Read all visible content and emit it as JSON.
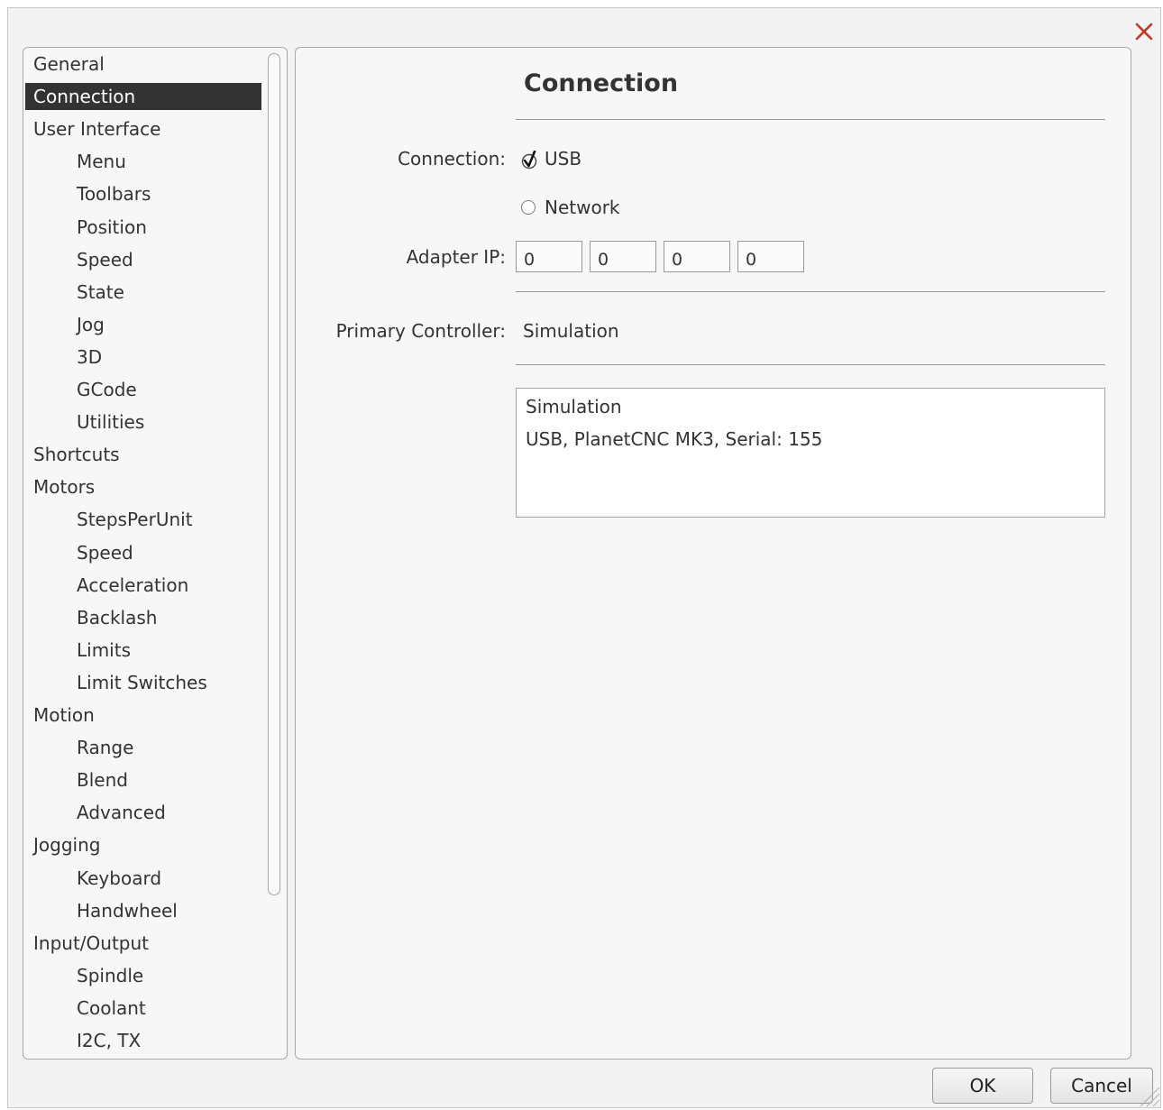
{
  "sidebar": {
    "items": [
      {
        "label": "General",
        "level": 0,
        "selected": false
      },
      {
        "label": "Connection",
        "level": 0,
        "selected": true
      },
      {
        "label": "User Interface",
        "level": 0,
        "selected": false
      },
      {
        "label": "Menu",
        "level": 1,
        "selected": false
      },
      {
        "label": "Toolbars",
        "level": 1,
        "selected": false
      },
      {
        "label": "Position",
        "level": 1,
        "selected": false
      },
      {
        "label": "Speed",
        "level": 1,
        "selected": false
      },
      {
        "label": "State",
        "level": 1,
        "selected": false
      },
      {
        "label": "Jog",
        "level": 1,
        "selected": false
      },
      {
        "label": "3D",
        "level": 1,
        "selected": false
      },
      {
        "label": "GCode",
        "level": 1,
        "selected": false
      },
      {
        "label": "Utilities",
        "level": 1,
        "selected": false
      },
      {
        "label": "Shortcuts",
        "level": 0,
        "selected": false
      },
      {
        "label": "Motors",
        "level": 0,
        "selected": false
      },
      {
        "label": "StepsPerUnit",
        "level": 1,
        "selected": false
      },
      {
        "label": "Speed",
        "level": 1,
        "selected": false
      },
      {
        "label": "Acceleration",
        "level": 1,
        "selected": false
      },
      {
        "label": "Backlash",
        "level": 1,
        "selected": false
      },
      {
        "label": "Limits",
        "level": 1,
        "selected": false
      },
      {
        "label": "Limit Switches",
        "level": 1,
        "selected": false
      },
      {
        "label": "Motion",
        "level": 0,
        "selected": false
      },
      {
        "label": "Range",
        "level": 1,
        "selected": false
      },
      {
        "label": "Blend",
        "level": 1,
        "selected": false
      },
      {
        "label": "Advanced",
        "level": 1,
        "selected": false
      },
      {
        "label": "Jogging",
        "level": 0,
        "selected": false
      },
      {
        "label": "Keyboard",
        "level": 1,
        "selected": false
      },
      {
        "label": "Handwheel",
        "level": 1,
        "selected": false
      },
      {
        "label": "Input/Output",
        "level": 0,
        "selected": false
      },
      {
        "label": "Spindle",
        "level": 1,
        "selected": false
      },
      {
        "label": "Coolant",
        "level": 1,
        "selected": false
      },
      {
        "label": "I2C, TX",
        "level": 1,
        "selected": false
      }
    ]
  },
  "main": {
    "title": "Connection",
    "connection": {
      "label": "Connection:",
      "usb_label": "USB",
      "usb_checked": true,
      "network_label": "Network",
      "network_selected": false
    },
    "adapter_ip": {
      "label": "Adapter IP:",
      "octets": [
        "0",
        "0",
        "0",
        "0"
      ]
    },
    "primary_controller": {
      "label": "Primary Controller:",
      "value": "Simulation"
    },
    "controller_list": [
      "Simulation",
      "USB, PlanetCNC MK3, Serial: 155"
    ]
  },
  "buttons": {
    "ok": "OK",
    "cancel": "Cancel"
  },
  "icons": {
    "close": "close-icon",
    "checkmark": "checkmark-icon",
    "resize": "resize-grip-icon"
  },
  "colors": {
    "close_icon": "#c0392b",
    "selected_background": "#333333",
    "selected_text": "#ffffff"
  }
}
